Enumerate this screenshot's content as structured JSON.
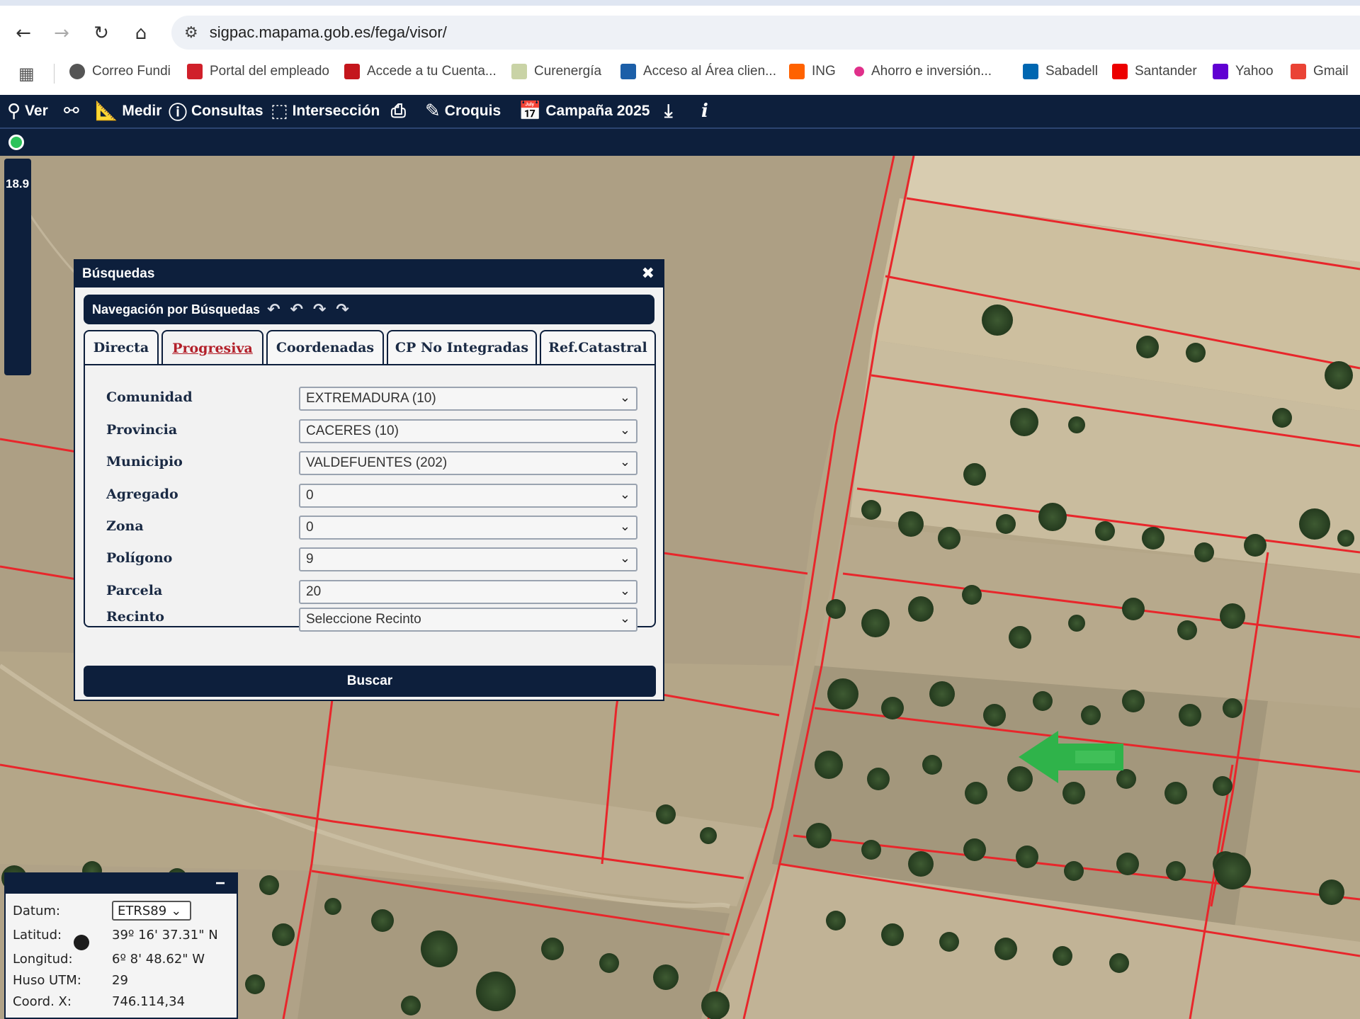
{
  "browser": {
    "url": "sigpac.mapama.gob.es/fega/visor/",
    "bookmarks": [
      {
        "label": "Correo Fundi",
        "color": "#555555"
      },
      {
        "label": "Portal del empleado",
        "color": "#d0202a"
      },
      {
        "label": "Accede a tu Cuenta...",
        "color": "#c4161c"
      },
      {
        "label": "Curenergía",
        "color": "#c9d3a6"
      },
      {
        "label": "Acceso al Área clien...",
        "color": "#1c5fa8"
      },
      {
        "label": "ING",
        "color": "#ff6200"
      },
      {
        "label": "Ahorro e inversión...",
        "color": "#e0308a"
      },
      {
        "label": "Sabadell",
        "color": "#0067b1"
      },
      {
        "label": "Santander",
        "color": "#ec0000"
      },
      {
        "label": "Yahoo",
        "color": "#6001d2"
      },
      {
        "label": "Gmail",
        "color": "#ea4335"
      }
    ]
  },
  "toolbar": {
    "ver": "Ver",
    "medir": "Medir",
    "consultas": "Consultas",
    "interseccion": "Intersección",
    "croquis": "Croquis",
    "campana": "Campaña 2025"
  },
  "zoom": {
    "level": "18.9"
  },
  "search_panel": {
    "title": "Búsquedas",
    "nav_title": "Navegación por Búsquedas",
    "tabs": [
      "Directa",
      "Progresiva",
      "Coordenadas",
      "CP No Integradas",
      "Ref.Catastral"
    ],
    "active_tab": "Progresiva",
    "fields": [
      {
        "label": "Comunidad",
        "value": "EXTREMADURA (10)"
      },
      {
        "label": "Provincia",
        "value": "CACERES (10)"
      },
      {
        "label": "Municipio",
        "value": "VALDEFUENTES (202)"
      },
      {
        "label": "Agregado",
        "value": "0"
      },
      {
        "label": "Zona",
        "value": "0"
      },
      {
        "label": "Polígono",
        "value": "9"
      },
      {
        "label": "Parcela",
        "value": "20"
      },
      {
        "label": "Recinto",
        "value": "Seleccione Recinto"
      }
    ],
    "search_button": "Buscar"
  },
  "coords": {
    "datum_label": "Datum:",
    "datum_value": "ETRS89",
    "lat_label": "Latitud:",
    "lat_value": "39º 16' 37.31\" N",
    "lon_label": "Longitud:",
    "lon_value": "6º 8' 48.62\" W",
    "huso_label": "Huso UTM:",
    "huso_value": "29",
    "x_label": "Coord. X:",
    "x_value": "746.114,34"
  },
  "colors": {
    "app_navy": "#0d1f3c",
    "parcel_line": "#e8262b",
    "marker_green": "#2fb34a",
    "active_tab_text": "#b3202a"
  }
}
